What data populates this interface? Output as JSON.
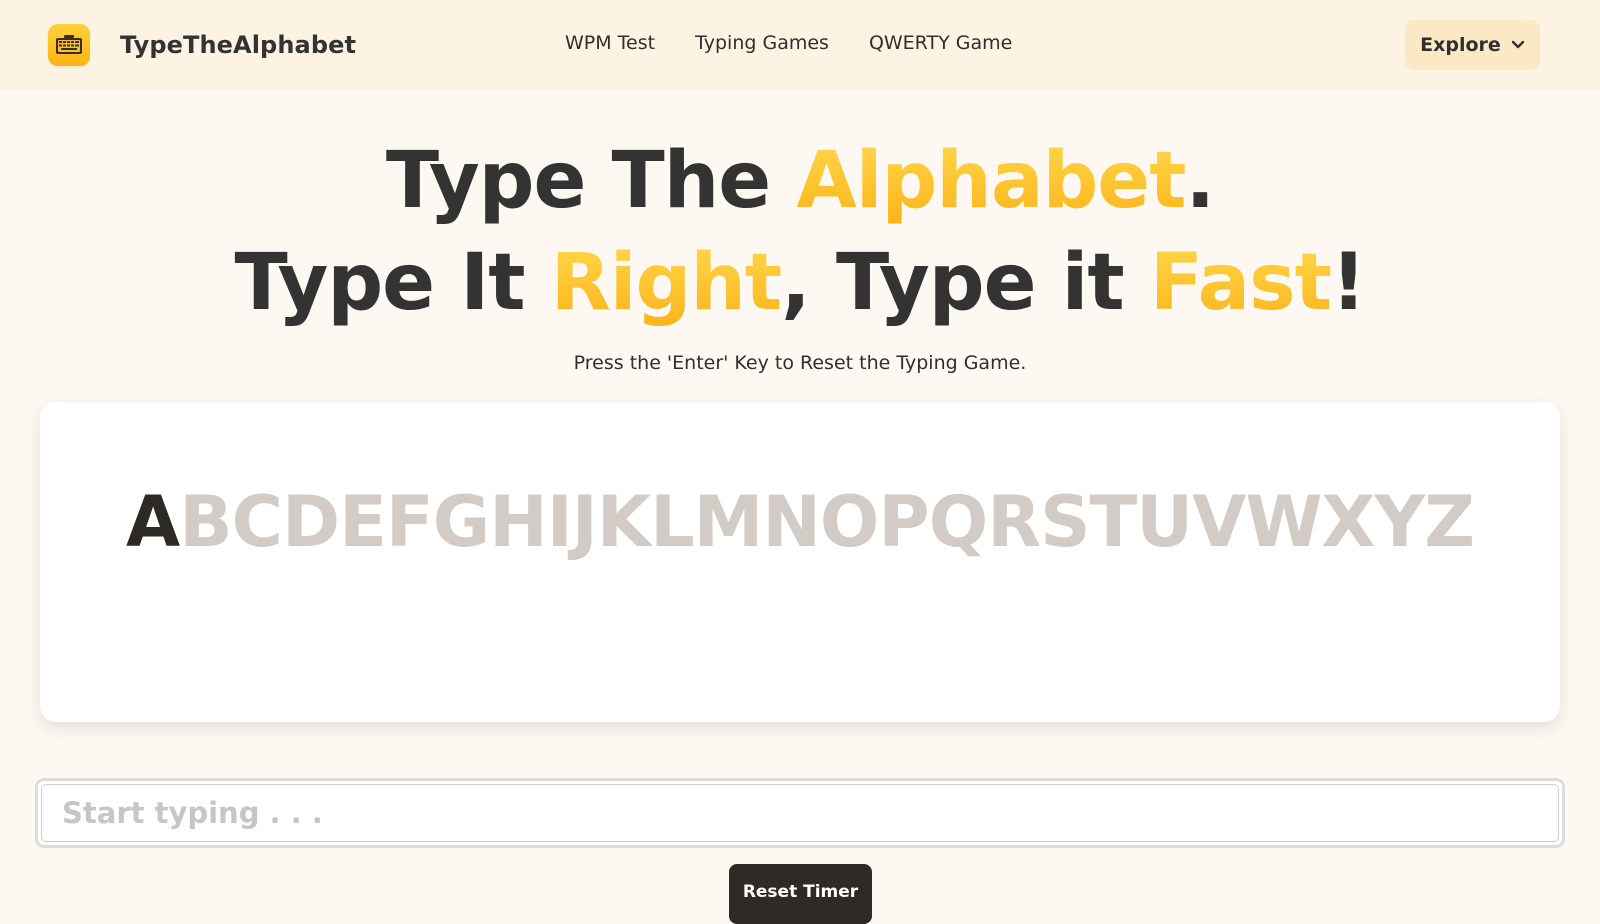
{
  "nav": {
    "brand": "TypeTheAlphabet",
    "links": [
      "WPM Test",
      "Typing Games",
      "QWERTY Game"
    ],
    "explore_label": "Explore"
  },
  "hero": {
    "line1": {
      "part1": "Type The ",
      "accent1": "Alphabet",
      "part2": "."
    },
    "line2": {
      "part1": "Type It ",
      "accent1": "Right",
      "part2": ", Type it ",
      "accent2": "Fast",
      "part3": "!"
    },
    "subtitle": "Press the 'Enter' Key to Reset the Typing Game."
  },
  "game": {
    "current_letter": "A",
    "remaining_letters": "BCDEFGHIJKLMNOPQRSTUVWXYZ"
  },
  "input": {
    "placeholder": "Start typing . . .",
    "value": ""
  },
  "reset_label": "Reset Timer",
  "colors": {
    "accent_gradient_top": "#ffd84a",
    "accent_gradient_bottom": "#fbb31a",
    "navbar_bg": "#fcf3e3",
    "page_bg": "#fdf9f2",
    "letter_inactive": "#d3ccc6",
    "letter_active": "#2d2a26",
    "reset_button_bg": "#2f2a25"
  },
  "icons": {
    "logo": "keyboard-icon",
    "explore": "chevron-down-icon"
  }
}
